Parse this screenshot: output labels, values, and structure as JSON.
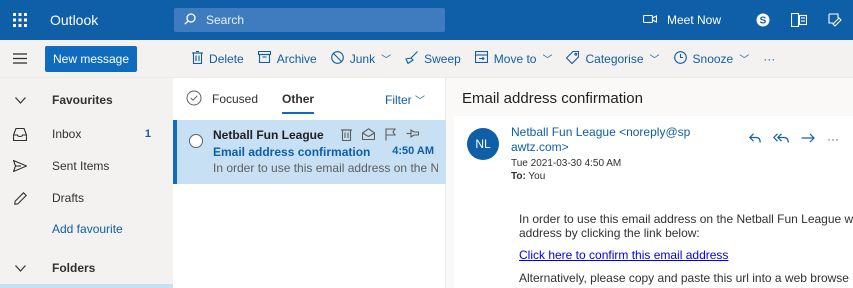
{
  "topbar": {
    "app_name": "Outlook",
    "search_placeholder": "Search",
    "meet_now": "Meet Now"
  },
  "commands": {
    "new_message": "New message",
    "delete": "Delete",
    "archive": "Archive",
    "junk": "Junk",
    "sweep": "Sweep",
    "move_to": "Move to",
    "categorise": "Categorise",
    "snooze": "Snooze",
    "more": "···"
  },
  "nav": {
    "favourites": "Favourites",
    "inbox": "Inbox",
    "inbox_count": "1",
    "sent": "Sent Items",
    "drafts": "Drafts",
    "add_favourite": "Add favourite",
    "folders": "Folders"
  },
  "list": {
    "focused": "Focused",
    "other": "Other",
    "filter": "Filter",
    "message": {
      "sender": "Netball Fun League",
      "subject": "Email address confirmation",
      "time": "4:50 AM",
      "preview": "In order to use this email address on the Ne..."
    }
  },
  "reading": {
    "title": "Email address confirmation",
    "avatar_initials": "NL",
    "from_line1": "Netball Fun League <noreply@sp",
    "from_line2": "awtz.com>",
    "date": "Tue 2021-03-30 4:50 AM",
    "to_label": "To:",
    "to_value": "You",
    "body_line1": "In order to use this email address on the Netball Fun League w",
    "body_line2": "address by clicking the link below:",
    "link_text": "Click here to confirm this email address",
    "body_line3": "Alternatively, please copy and paste this url into a web browse"
  },
  "colors": {
    "brand": "#0f5ea8",
    "selected_bg": "#c7e0f4"
  }
}
